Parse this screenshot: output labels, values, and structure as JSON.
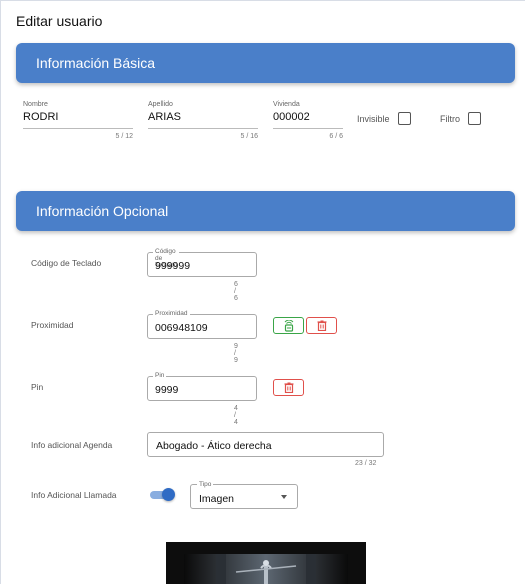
{
  "page_title": "Editar usuario",
  "basic_section": {
    "title": "Información Básica",
    "nombre": {
      "label": "Nombre",
      "value": "RODRI",
      "counter": "5 / 12"
    },
    "apellido": {
      "label": "Apellido",
      "value": "ARIAS",
      "counter": "5 / 16"
    },
    "vivienda": {
      "label": "Vivienda",
      "value": "000002",
      "counter": "6 / 6"
    },
    "invisible_label": "Invisible",
    "filtro_label": "Filtro"
  },
  "optional_section": {
    "title": "Información Opcional",
    "codigo": {
      "row_label": "Código de Teclado",
      "field_label": "Código de Teclado",
      "value": "999999",
      "counter": "6 / 6"
    },
    "proximidad": {
      "row_label": "Proximidad",
      "field_label": "Proximidad",
      "value": "006948109",
      "counter": "9 / 9"
    },
    "pin": {
      "row_label": "Pin",
      "field_label": "Pin",
      "value": "9999",
      "counter": "4 / 4"
    },
    "agenda": {
      "row_label": "Info adicional Agenda",
      "value": "Abogado - Ático derecha",
      "counter": "23 / 32"
    },
    "llamada": {
      "row_label": "Info Adicional Llamada",
      "toggle_on": true,
      "type_label": "Tipo",
      "type_value": "Imagen"
    }
  },
  "colors": {
    "header_blue": "#4a7fc9",
    "green": "#3aa547",
    "red": "#e0504b",
    "toggle": "#2f6bc4"
  }
}
